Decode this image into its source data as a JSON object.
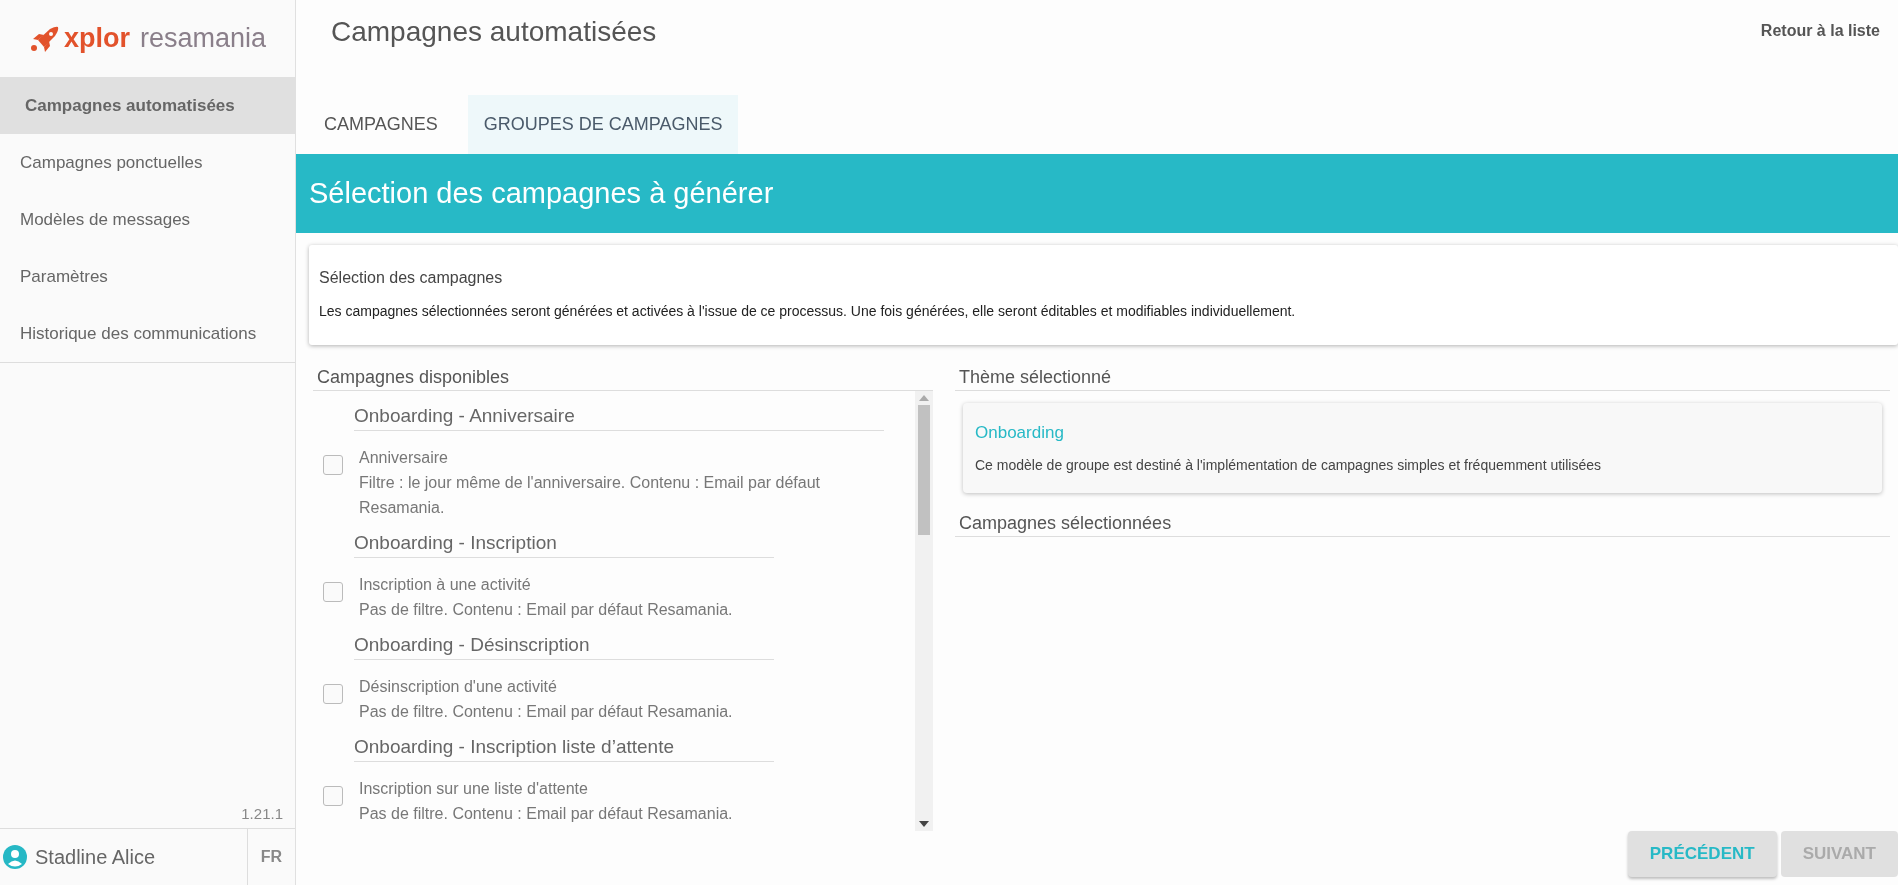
{
  "logo": {
    "brand": "xplor",
    "product": "resamania"
  },
  "sidebar": {
    "items": [
      {
        "label": "Campagnes automatisées",
        "selected": true
      },
      {
        "label": "Campagnes ponctuelles",
        "selected": false
      },
      {
        "label": "Modèles de messages",
        "selected": false
      },
      {
        "label": "Paramètres",
        "selected": false
      },
      {
        "label": "Historique des communications",
        "selected": false
      }
    ],
    "version": "1.21.1",
    "user": "Stadline Alice",
    "language": "FR"
  },
  "header": {
    "title": "Campagnes automatisées",
    "back_link": "Retour à la liste"
  },
  "tabs": [
    {
      "label": "CAMPAGNES",
      "selected": false
    },
    {
      "label": "GROUPES DE CAMPAGNES",
      "selected": true
    }
  ],
  "banner": {
    "title": "Sélection des campagnes à générer"
  },
  "info": {
    "title": "Sélection des campagnes",
    "text": "Les campagnes sélectionnées seront générées et activées à l'issue de ce processus. Une fois générées, elle seront éditables et modifiables individuellement."
  },
  "available": {
    "title": "Campagnes disponibles",
    "groups": [
      {
        "title": "Onboarding - Anniversaire",
        "campaigns": [
          {
            "name": "Anniversaire",
            "description": "Filtre : le jour même de l'anniversaire. Contenu : Email par défaut Resamania.",
            "checked": false
          }
        ]
      },
      {
        "title": "Onboarding - Inscription",
        "campaigns": [
          {
            "name": "Inscription à une activité",
            "description": "Pas de filtre. Contenu : Email par défaut Resamania.",
            "checked": false
          }
        ]
      },
      {
        "title": "Onboarding - Désinscription",
        "campaigns": [
          {
            "name": "Désinscription d'une activité",
            "description": "Pas de filtre. Contenu : Email par défaut Resamania.",
            "checked": false
          }
        ]
      },
      {
        "title": "Onboarding - Inscription liste d’attente",
        "campaigns": [
          {
            "name": "Inscription sur une liste d'attente",
            "description": "Pas de filtre. Contenu : Email par défaut Resamania.",
            "checked": false
          }
        ]
      }
    ]
  },
  "theme": {
    "title": "Thème sélectionné",
    "name": "Onboarding",
    "description": "Ce modèle de groupe est destiné à l'implémentation de campagnes simples et fréquemment utilisées"
  },
  "selected": {
    "title": "Campagnes sélectionnées"
  },
  "buttons": [
    {
      "label": "PRÉCÉDENT",
      "disabled": false
    },
    {
      "label": "SUIVANT",
      "disabled": true
    }
  ]
}
